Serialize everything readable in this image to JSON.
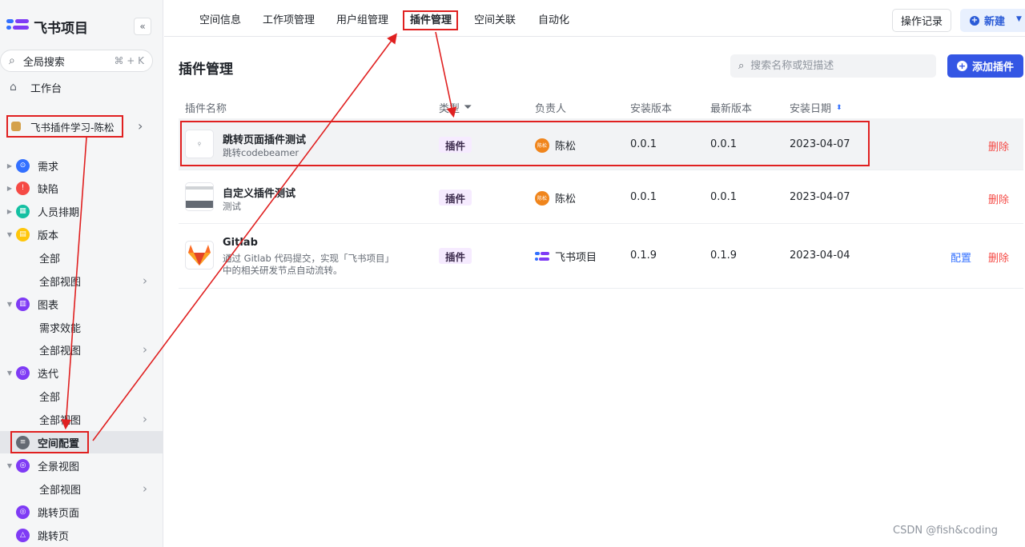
{
  "brand": {
    "title": "飞书项目",
    "collapse_icon": "«"
  },
  "sidebar": {
    "search_label": "全局搜索",
    "search_shortcut": "⌘ + K",
    "workbench": "工作台",
    "project": "飞书插件学习-陈松",
    "tree": [
      {
        "label": "需求",
        "color": "#3370ff",
        "glyph": "⊙"
      },
      {
        "label": "缺陷",
        "color": "#f54a45",
        "glyph": "!"
      },
      {
        "label": "人员排期",
        "color": "#14c0a2",
        "glyph": "▦"
      },
      {
        "label": "版本",
        "color": "#ffc60a",
        "glyph": "▤"
      },
      {
        "label": "全部"
      },
      {
        "label": "全部视图"
      },
      {
        "label": "图表",
        "color": "#7f3bf5",
        "glyph": "▥"
      },
      {
        "label": "需求效能"
      },
      {
        "label": "全部视图"
      },
      {
        "label": "迭代",
        "color": "#7f3bf5",
        "glyph": "◎"
      },
      {
        "label": "全部"
      },
      {
        "label": "全部视图"
      },
      {
        "label": "空间配置",
        "color": "#646a73",
        "glyph": "≡"
      },
      {
        "label": "全景视图",
        "color": "#7f3bf5",
        "glyph": "◎"
      },
      {
        "label": "全部视图"
      },
      {
        "label": "跳转页面",
        "color": "#7f3bf5",
        "glyph": "◎"
      },
      {
        "label": "跳转页",
        "color": "#7f3bf5",
        "glyph": "△"
      }
    ]
  },
  "tabs": [
    "空间信息",
    "工作项管理",
    "用户组管理",
    "插件管理",
    "空间关联",
    "自动化"
  ],
  "toolbar": {
    "oplog": "操作记录",
    "new": "新建"
  },
  "page": {
    "title": "插件管理",
    "search_placeholder": "搜索名称或短描述",
    "add_button": "添加插件"
  },
  "table": {
    "headers": [
      "插件名称",
      "类型",
      "负责人",
      "安装版本",
      "最新版本",
      "安装日期"
    ],
    "rows": [
      {
        "name": "跳转页面插件测试",
        "desc": "跳转codebeamer",
        "type": "插件",
        "owner": "陈松",
        "owner_avatar": "陈松",
        "installed": "0.0.1",
        "latest": "0.0.1",
        "date": "2023-04-07",
        "actions": [
          "删除"
        ]
      },
      {
        "name": "自定义插件测试",
        "desc": "测试",
        "type": "插件",
        "owner": "陈松",
        "owner_avatar": "陈松",
        "installed": "0.0.1",
        "latest": "0.0.1",
        "date": "2023-04-07",
        "actions": [
          "删除"
        ]
      },
      {
        "name": "Gitlab",
        "desc": "通过 Gitlab 代码提交，实现「飞书项目」中的相关研发节点自动流转。",
        "type": "插件",
        "owner": "飞书项目",
        "installed": "0.1.9",
        "latest": "0.1.9",
        "date": "2023-04-04",
        "actions": [
          "配置",
          "删除"
        ]
      }
    ]
  },
  "watermark": "CSDN @fish&coding"
}
